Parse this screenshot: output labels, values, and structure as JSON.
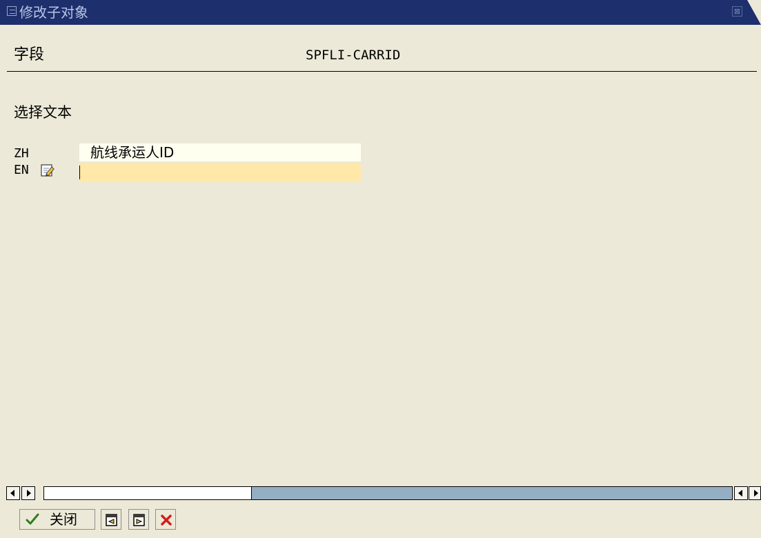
{
  "window": {
    "title": "修改子对象",
    "close_glyph": "⊠"
  },
  "field": {
    "label": "字段",
    "value": "SPFLI-CARRID"
  },
  "section": {
    "label": "选择文本"
  },
  "languages": [
    {
      "code": "ZH",
      "text": "航线承运人ID"
    },
    {
      "code": "EN",
      "text": ""
    }
  ],
  "toolbar": {
    "close_label": "关闭",
    "buttons": [
      "confirm-icon",
      "previous-entry-icon",
      "next-entry-icon",
      "cancel-icon"
    ]
  },
  "colors": {
    "titlebar": "#1E2F6E",
    "background": "#ECE9D8",
    "input_readonly": "#FFFFF0",
    "input_active": "#FFE8A8",
    "scroll_track": "#94AFC4"
  }
}
